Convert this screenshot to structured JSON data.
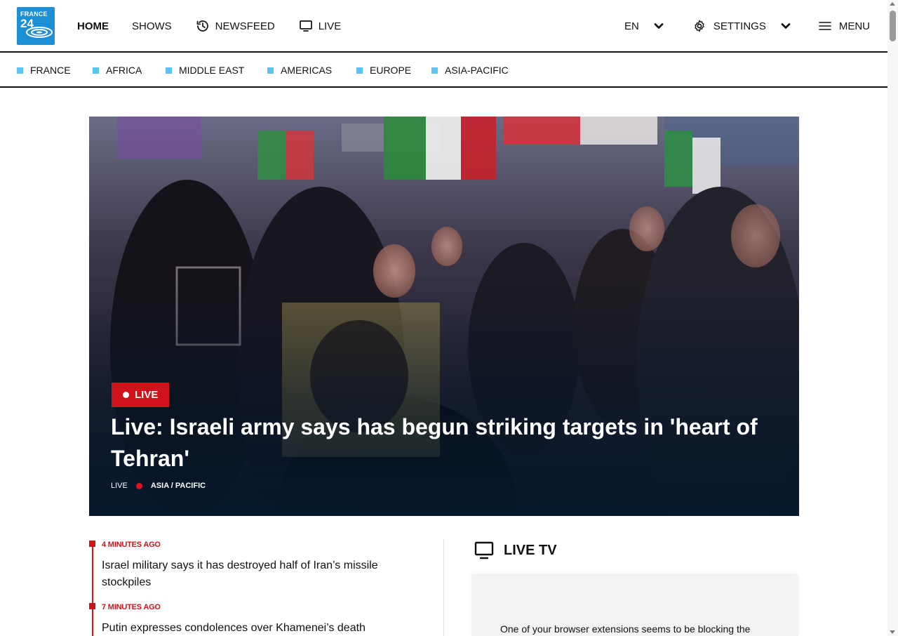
{
  "brand": {
    "line1": "FRANCE",
    "line2": "24",
    "color": "#1d8fd6"
  },
  "nav": {
    "home": "HOME",
    "shows": "SHOWS",
    "newsfeed": "NEWSFEED",
    "live": "LIVE",
    "icons": {
      "newsfeed": "history-icon",
      "live": "monitor-icon"
    }
  },
  "right_nav": {
    "language": "EN",
    "settings": "SETTINGS",
    "menu": "MENU"
  },
  "regions": [
    {
      "label": "FRANCE"
    },
    {
      "label": "AFRICA"
    },
    {
      "label": "MIDDLE EAST"
    },
    {
      "label": "AMERICAS"
    },
    {
      "label": "EUROPE"
    },
    {
      "label": "ASIA-PACIFIC"
    }
  ],
  "region_marker_color": "#5bc4f1",
  "hero": {
    "badge": "LIVE",
    "title": "Live: Israeli army says has begun striking targets in 'heart of Tehran'",
    "meta_live": "LIVE",
    "meta_category": "ASIA / PACIFIC",
    "accent": "#d0131b"
  },
  "feed": [
    {
      "time": "4 MINUTES AGO",
      "text": "Israel military says it has destroyed half of Iran’s missile stockpiles"
    },
    {
      "time": "7 MINUTES AGO",
      "text": "Putin expresses condolences over Khamenei’s death"
    }
  ],
  "live_tv": {
    "title": "LIVE TV",
    "message": "One of your browser extensions seems to be blocking the"
  }
}
